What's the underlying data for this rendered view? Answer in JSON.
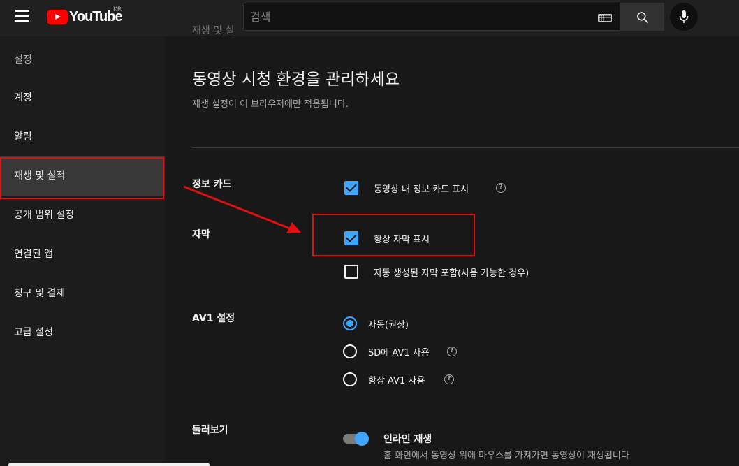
{
  "header": {
    "logo_text": "YouTube",
    "region_code": "KR",
    "search_placeholder": "검색"
  },
  "sidebar": {
    "title": "설정",
    "items": [
      {
        "label": "계정"
      },
      {
        "label": "알림"
      },
      {
        "label": "재생 및 실적",
        "selected": true
      },
      {
        "label": "공개 범위 설정"
      },
      {
        "label": "연결된 앱"
      },
      {
        "label": "청구 및 결제"
      },
      {
        "label": "고급 설정"
      }
    ]
  },
  "main": {
    "top_hint": "재생 및 실",
    "title": "동영상 시청 환경을 관리하세요",
    "subtitle": "재생 설정이 이 브라우저에만 적용됩니다.",
    "info_cards": {
      "label": "정보 카드",
      "option": {
        "text": "동영상 내 정보 카드 표시",
        "checked": true
      }
    },
    "captions": {
      "label": "자막",
      "options": [
        {
          "text": "항상 자막 표시",
          "checked": true
        },
        {
          "text": "자동 생성된 자막 포함(사용 가능한 경우)",
          "checked": false
        }
      ]
    },
    "av1": {
      "label": "AV1 설정",
      "options": [
        {
          "text": "자동(권장)",
          "selected": true
        },
        {
          "text": "SD에 AV1 사용",
          "selected": false
        },
        {
          "text": "항상 AV1 사용",
          "selected": false
        }
      ]
    },
    "browse": {
      "label": "둘러보기",
      "toggle_title": "인라인 재생",
      "toggle_on": true,
      "toggle_desc": "홈 화면에서 동영상 위에 마우스를 가져가면 동영상이 재생됩니다"
    },
    "help_glyph": "?"
  },
  "colors": {
    "accent": "#3ea6ff",
    "annotation": "#e01010",
    "brand": "#ff0000"
  }
}
